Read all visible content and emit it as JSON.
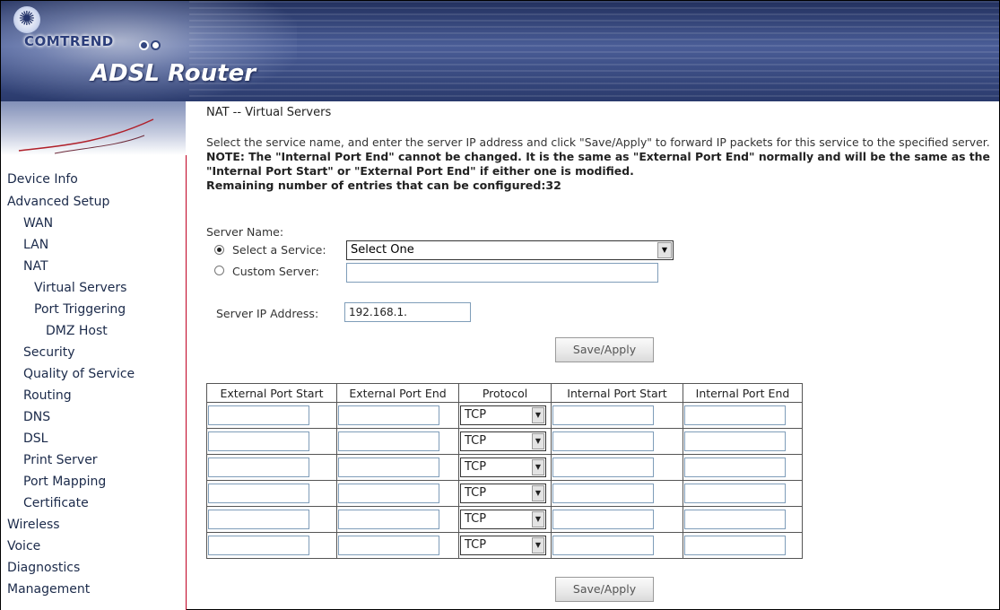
{
  "header": {
    "brand": "COMTREND",
    "product": "ADSL Router"
  },
  "sidebar": {
    "items": [
      {
        "label": "Device Info"
      },
      {
        "label": "Advanced Setup"
      },
      {
        "label": "WAN"
      },
      {
        "label": "LAN"
      },
      {
        "label": "NAT"
      },
      {
        "label": "Virtual Servers"
      },
      {
        "label": "Port Triggering"
      },
      {
        "label": "DMZ Host"
      },
      {
        "label": "Security"
      },
      {
        "label": "Quality of Service"
      },
      {
        "label": "Routing"
      },
      {
        "label": "DNS"
      },
      {
        "label": "DSL"
      },
      {
        "label": "Print Server"
      },
      {
        "label": "Port Mapping"
      },
      {
        "label": "Certificate"
      },
      {
        "label": "Wireless"
      },
      {
        "label": "Voice"
      },
      {
        "label": "Diagnostics"
      },
      {
        "label": "Management"
      }
    ]
  },
  "main": {
    "title": "NAT -- Virtual Servers",
    "desc_1": "Select the service name, and enter the server IP address and click \"Save/Apply\" to forward IP packets for this service to the specified server. ",
    "desc_note": "NOTE: The \"Internal Port End\" cannot be changed. It is the same as \"External Port End\" normally and will be the same as the \"Internal Port Start\" or \"External Port End\" if either one is modified.",
    "remaining": "Remaining number of entries that can be configured:32",
    "server_name_label": "Server Name:",
    "select_service_label": "Select a Service:",
    "select_service_value": "Select One",
    "custom_server_label": "Custom Server:",
    "custom_server_value": "",
    "server_ip_label": "Server IP Address:",
    "server_ip_value": "192.168.1.",
    "save_apply": "Save/Apply"
  },
  "table": {
    "headers": [
      "External Port Start",
      "External Port End",
      "Protocol",
      "Internal Port Start",
      "Internal Port End"
    ],
    "rows": [
      {
        "protocol": "TCP"
      },
      {
        "protocol": "TCP"
      },
      {
        "protocol": "TCP"
      },
      {
        "protocol": "TCP"
      },
      {
        "protocol": "TCP"
      },
      {
        "protocol": "TCP"
      }
    ]
  },
  "colors": {
    "sidebar_border": "#c00022",
    "banner": "#33467f"
  }
}
